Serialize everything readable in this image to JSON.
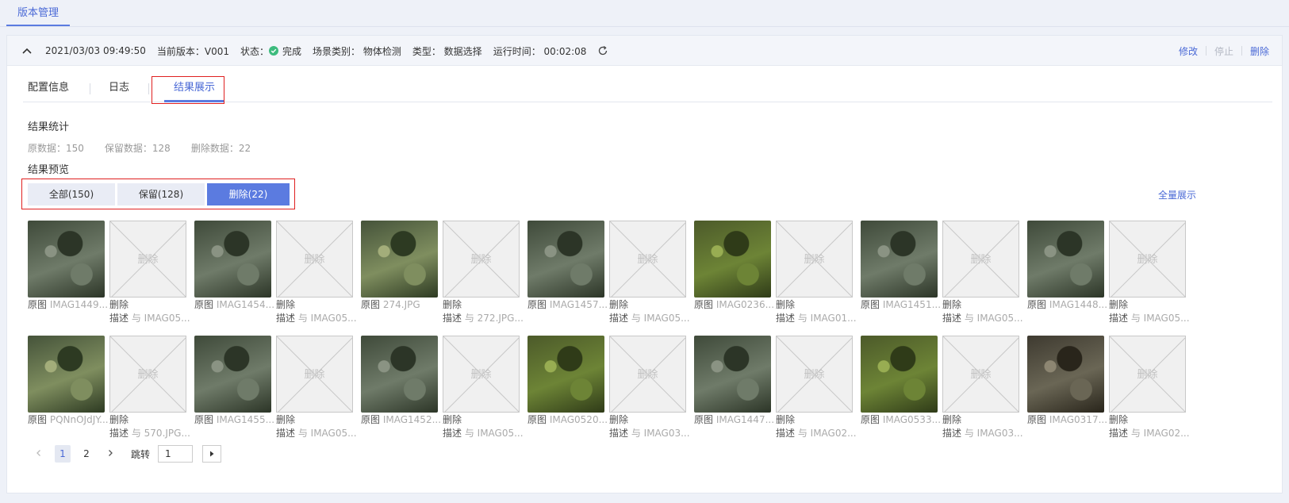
{
  "top_tab": "版本管理",
  "header": {
    "datetime": "2021/03/03 09:49:50",
    "version": "当前版本：V001",
    "status_label": "状态：",
    "status_value": "完成",
    "scene": "场景类别：  物体检测",
    "type": "类型：  数据选择",
    "runtime": "运行时间：  00:02:08",
    "actions": {
      "edit": "修改",
      "stop": "停止",
      "delete": "删除"
    },
    "status_color": "#3dbb7e"
  },
  "detail_tabs": [
    "配置信息",
    "日志",
    "结果展示"
  ],
  "stats": {
    "title": "结果统计",
    "original": "原数据：150",
    "kept": "保留数据：128",
    "deleted": "删除数据：22"
  },
  "preview": {
    "title": "结果预览",
    "filters": [
      "全部(150)",
      "保留(128)",
      "删除(22)"
    ],
    "full_show": "全量展示",
    "placeholder_text": "删除"
  },
  "items": [
    {
      "orig_label": "原图",
      "orig_name": "IMAG1449....",
      "del_label": "删除",
      "desc_label": "描述",
      "desc_text": "与 IMAG05..."
    },
    {
      "orig_label": "原图",
      "orig_name": "IMAG1454....",
      "del_label": "删除",
      "desc_label": "描述",
      "desc_text": "与 IMAG05..."
    },
    {
      "orig_label": "原图",
      "orig_name": "274.JPG",
      "del_label": "删除",
      "desc_label": "描述",
      "desc_text": "与 272.JPG..."
    },
    {
      "orig_label": "原图",
      "orig_name": "IMAG1457....",
      "del_label": "删除",
      "desc_label": "描述",
      "desc_text": "与 IMAG05..."
    },
    {
      "orig_label": "原图",
      "orig_name": "IMAG0236....",
      "del_label": "删除",
      "desc_label": "描述",
      "desc_text": "与 IMAG01..."
    },
    {
      "orig_label": "原图",
      "orig_name": "IMAG1451....",
      "del_label": "删除",
      "desc_label": "描述",
      "desc_text": "与 IMAG05..."
    },
    {
      "orig_label": "原图",
      "orig_name": "IMAG1448....",
      "del_label": "删除",
      "desc_label": "描述",
      "desc_text": "与 IMAG05..."
    },
    {
      "orig_label": "原图",
      "orig_name": "PQNnOJdJY...",
      "del_label": "删除",
      "desc_label": "描述",
      "desc_text": "与 570.JPG..."
    },
    {
      "orig_label": "原图",
      "orig_name": "IMAG1455....",
      "del_label": "删除",
      "desc_label": "描述",
      "desc_text": "与 IMAG05..."
    },
    {
      "orig_label": "原图",
      "orig_name": "IMAG1452....",
      "del_label": "删除",
      "desc_label": "描述",
      "desc_text": "与 IMAG05..."
    },
    {
      "orig_label": "原图",
      "orig_name": "IMAG0520....",
      "del_label": "删除",
      "desc_label": "描述",
      "desc_text": "与 IMAG03..."
    },
    {
      "orig_label": "原图",
      "orig_name": "IMAG1447....",
      "del_label": "删除",
      "desc_label": "描述",
      "desc_text": "与 IMAG02..."
    },
    {
      "orig_label": "原图",
      "orig_name": "IMAG0533....",
      "del_label": "删除",
      "desc_label": "描述",
      "desc_text": "与 IMAG03..."
    },
    {
      "orig_label": "原图",
      "orig_name": "IMAG0317....",
      "del_label": "删除",
      "desc_label": "描述",
      "desc_text": "与 IMAG02..."
    }
  ],
  "pagination": {
    "pages": [
      "1",
      "2"
    ],
    "jump_label": "跳转",
    "jump_value": "1"
  }
}
